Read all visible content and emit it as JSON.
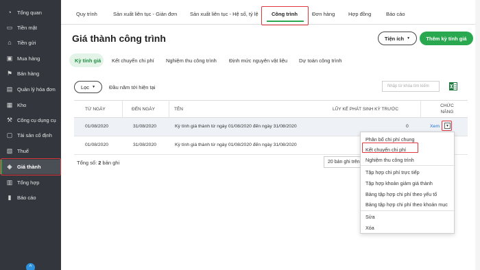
{
  "sidebar": {
    "items": [
      {
        "label": "Tổng quan",
        "icon": "dashboard-icon",
        "glyph": "◔"
      },
      {
        "label": "Tiền mặt",
        "icon": "cash-icon",
        "glyph": "▭"
      },
      {
        "label": "Tiền gửi",
        "icon": "bank-icon",
        "glyph": "⌂"
      },
      {
        "label": "Mua hàng",
        "icon": "purchase-icon",
        "glyph": "▣"
      },
      {
        "label": "Bán hàng",
        "icon": "cart-icon",
        "glyph": "⚑"
      },
      {
        "label": "Quản lý hóa đơn",
        "icon": "invoice-icon",
        "glyph": "▤"
      },
      {
        "label": "Kho",
        "icon": "warehouse-icon",
        "glyph": "▦"
      },
      {
        "label": "Công cụ dụng cụ",
        "icon": "tools-icon",
        "glyph": "⚒"
      },
      {
        "label": "Tài sản cố định",
        "icon": "asset-icon",
        "glyph": "▢"
      },
      {
        "label": "Thuế",
        "icon": "tax-icon",
        "glyph": "▧"
      },
      {
        "label": "Giá thành",
        "icon": "price-tag-icon",
        "glyph": "◈"
      },
      {
        "label": "Tổng hợp",
        "icon": "summary-icon",
        "glyph": "▥"
      },
      {
        "label": "Báo cáo",
        "icon": "report-icon",
        "glyph": "▮"
      }
    ],
    "active_index": 10,
    "collapse_glyph": "^"
  },
  "topnav": {
    "tabs": [
      "Quy trình",
      "Sản xuất liên tục - Giản đơn",
      "Sản xuất liên tục - Hệ số, tỷ lệ",
      "Công trình",
      "Đơn hàng",
      "Hợp đồng",
      "Báo cáo"
    ],
    "active_index": 3
  },
  "page": {
    "title": "Giá thành công trình",
    "utility_button": "Tiện ích",
    "add_button": "Thêm kỳ tính giá"
  },
  "subtabs": {
    "items": [
      "Kỳ tính giá",
      "Kết chuyển chi phí",
      "Nghiệm thu công trình",
      "Định mức nguyên vật liệu",
      "Dự toán công trình"
    ],
    "active_index": 0
  },
  "filter": {
    "filter_button": "Lọc",
    "period_label": "Đầu năm tới hiện tại",
    "search_placeholder": "Nhập từ khóa tìm kiếm"
  },
  "table": {
    "columns": [
      "Từ ngày",
      "Đến ngày",
      "Tên",
      "Lũy kế phát sinh kỳ trước",
      "Chức năng"
    ],
    "rows": [
      {
        "from": "01/08/2020",
        "to": "31/08/2020",
        "name": "Kỳ tính giá thành từ ngày 01/08/2020 đến ngày 31/08/2020",
        "accum": "0",
        "action": "Xem"
      },
      {
        "from": "01/08/2020",
        "to": "31/08/2020",
        "name": "Kỳ tính giá thành từ ngày 01/08/2020 đến ngày 31/08/2020",
        "accum": "",
        "action": ""
      }
    ],
    "total_prefix": "Tổng số: ",
    "total_count": "2",
    "total_suffix": " bản ghi",
    "page_size": "20 bản ghi trên 1 trang"
  },
  "dropdown_menu": {
    "items": [
      "Phân bổ chi phí chung",
      "Kết chuyển chi phí",
      "Nghiệm thu công trình",
      "Tập hợp chi phí trực tiếp",
      "Tập hợp khoản giảm giá thành",
      "Bảng tập hợp chi phí theo yếu tố",
      "Bảng tập hợp chi phí theo khoản mục",
      "Sửa",
      "Xóa"
    ],
    "highlighted_index": 1
  },
  "colors": {
    "accent": "#2aa84f",
    "highlight_box": "#e0353b",
    "sidebar_bg": "#33373d",
    "link": "#1e6fd8"
  }
}
